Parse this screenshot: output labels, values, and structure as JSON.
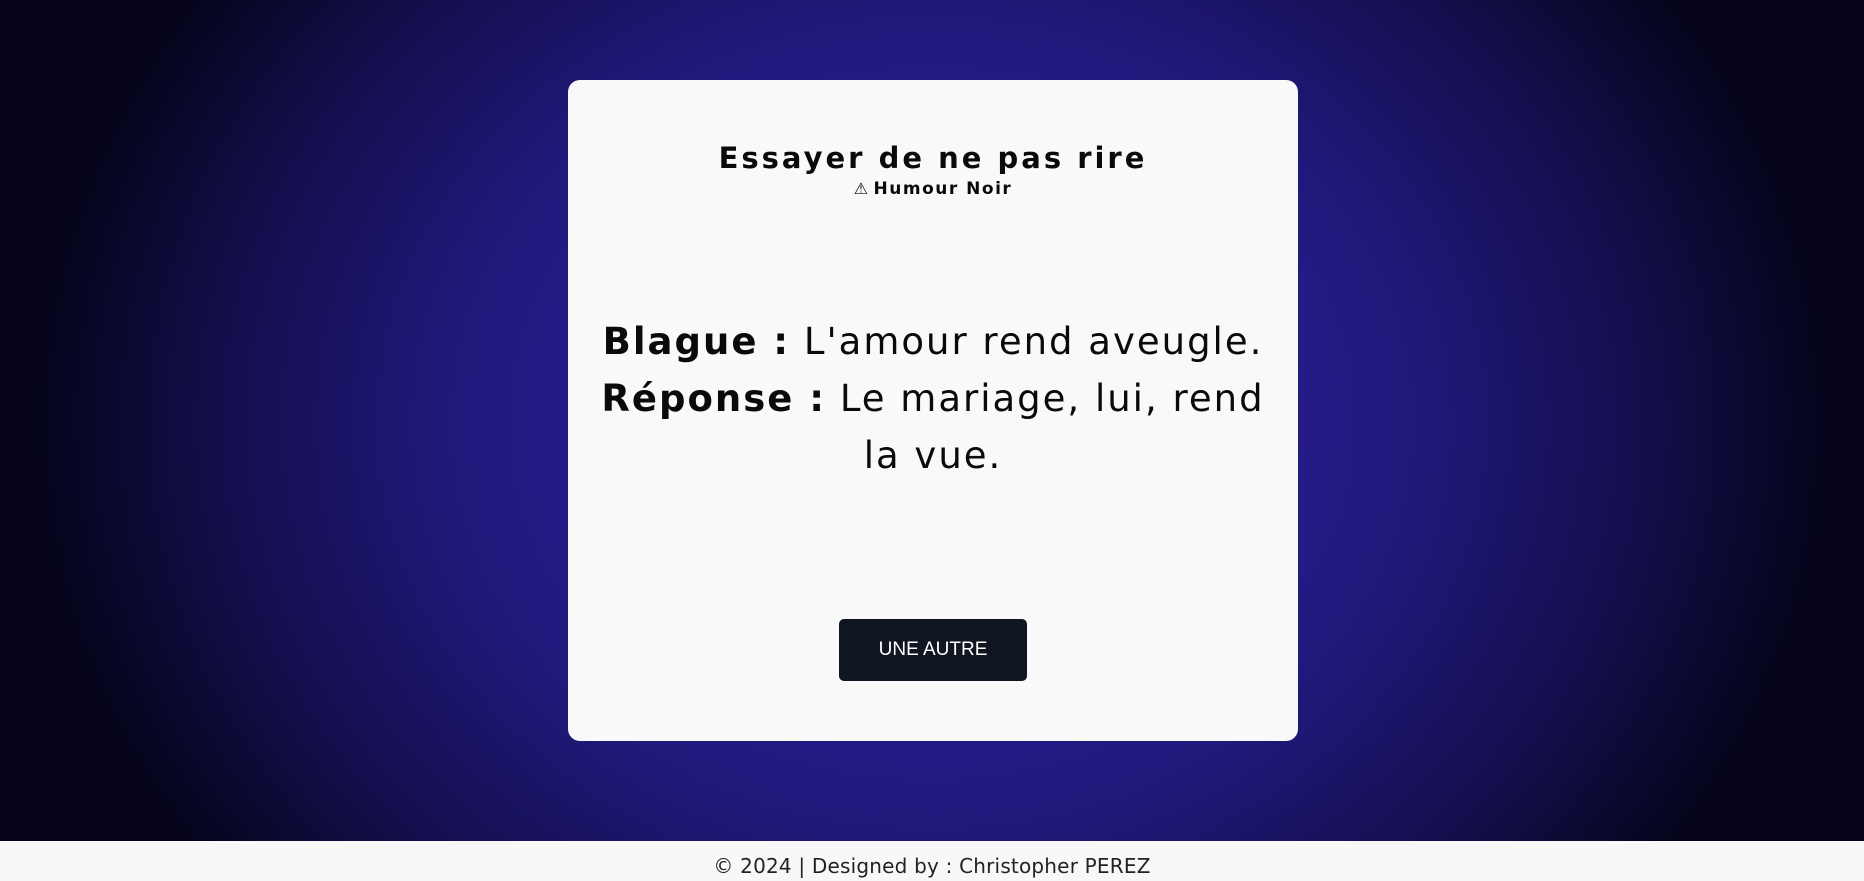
{
  "card": {
    "title": "Essayer de ne pas rire",
    "subtitle_icon": "⚠",
    "subtitle": "Humour Noir",
    "joke_label": "Blague :",
    "joke_text": "L'amour rend aveugle.",
    "answer_label": "Réponse :",
    "answer_text": "Le mariage, lui, rend la vue.",
    "button_label": "UNE AUTRE"
  },
  "footer": {
    "text": "© 2024 | Designed by : Christopher PEREZ"
  },
  "colors": {
    "background_center": "#3a2aa6",
    "background_edge": "#05041a",
    "card": "#f9f9f9",
    "button": "#0f1621",
    "footer": "#f8f8f8"
  }
}
